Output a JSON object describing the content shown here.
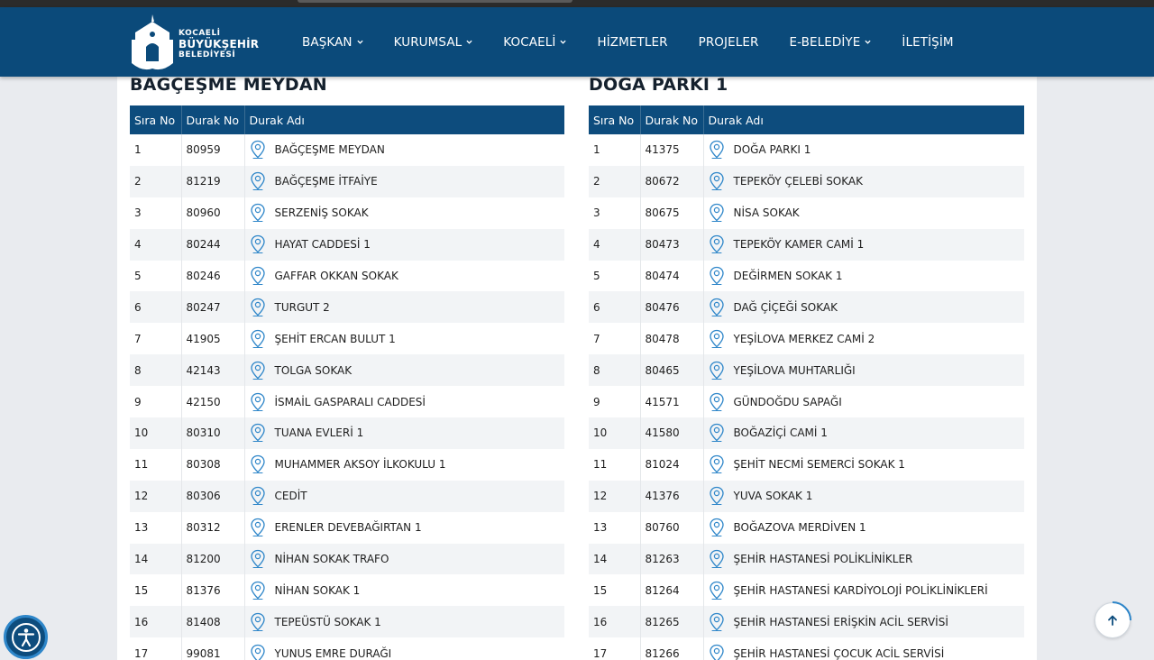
{
  "logo": {
    "line1": "KOCAELİ",
    "line2": "BÜYÜKŞEHİR",
    "line3": "BELEDİYESİ"
  },
  "nav": [
    {
      "label": "BAŞKAN",
      "dropdown": true
    },
    {
      "label": "KURUMSAL",
      "dropdown": true
    },
    {
      "label": "KOCAELİ",
      "dropdown": true
    },
    {
      "label": "HİZMETLER",
      "dropdown": false
    },
    {
      "label": "PROJELER",
      "dropdown": false
    },
    {
      "label": "E-BELEDİYE",
      "dropdown": true
    },
    {
      "label": "İLETİŞİM",
      "dropdown": false
    }
  ],
  "colors": {
    "header": "#0b4a7a",
    "table_header": "#0d4c7d",
    "accent": "#2e86c9"
  },
  "icons": {
    "stop": "map-pin-icon",
    "accessibility": "accessibility-icon",
    "scroll_top": "arrow-up-icon"
  },
  "columns": {
    "sira": "Sıra No",
    "durak_no": "Durak No",
    "durak_adi": "Durak Adı"
  },
  "left": {
    "title": "BAĞÇEŞME MEYDAN",
    "rows": [
      [
        "1",
        "80959",
        "BAĞÇEŞME MEYDAN"
      ],
      [
        "2",
        "81219",
        "BAĞÇEŞME İTFAİYE"
      ],
      [
        "3",
        "80960",
        "SERZENİŞ SOKAK"
      ],
      [
        "4",
        "80244",
        "HAYAT CADDESİ 1"
      ],
      [
        "5",
        "80246",
        "GAFFAR OKKAN SOKAK"
      ],
      [
        "6",
        "80247",
        "TURGUT 2"
      ],
      [
        "7",
        "41905",
        "ŞEHİT ERCAN BULUT 1"
      ],
      [
        "8",
        "42143",
        "TOLGA SOKAK"
      ],
      [
        "9",
        "42150",
        "İSMAİL GASPARALI CADDESİ"
      ],
      [
        "10",
        "80310",
        "TUANA EVLERİ 1"
      ],
      [
        "11",
        "80308",
        "MUHAMMER AKSOY İLKOKULU 1"
      ],
      [
        "12",
        "80306",
        "CEDİT"
      ],
      [
        "13",
        "80312",
        "ERENLER DEVEBAĞIRTAN 1"
      ],
      [
        "14",
        "81200",
        "NİHAN SOKAK TRAFO"
      ],
      [
        "15",
        "81376",
        "NİHAN SOKAK 1"
      ],
      [
        "16",
        "81408",
        "TEPEÜSTÜ SOKAK 1"
      ],
      [
        "17",
        "99081",
        "YUNUS EMRE DURAĞI"
      ]
    ]
  },
  "right": {
    "title": "DOĞA PARKI 1",
    "rows": [
      [
        "1",
        "41375",
        "DOĞA PARKI 1"
      ],
      [
        "2",
        "80672",
        "TEPEKÖY ÇELEBİ SOKAK"
      ],
      [
        "3",
        "80675",
        "NİSA SOKAK"
      ],
      [
        "4",
        "80473",
        "TEPEKÖY KAMER CAMİ 1"
      ],
      [
        "5",
        "80474",
        "DEĞİRMEN SOKAK 1"
      ],
      [
        "6",
        "80476",
        "DAĞ ÇİÇEĞİ SOKAK"
      ],
      [
        "7",
        "80478",
        "YEŞİLOVA MERKEZ CAMİ 2"
      ],
      [
        "8",
        "80465",
        "YEŞİLOVA MUHTARLIĞI"
      ],
      [
        "9",
        "41571",
        "GÜNDOĞDU SAPAĞI"
      ],
      [
        "10",
        "41580",
        "BOĞAZİÇİ CAMİ 1"
      ],
      [
        "11",
        "81024",
        "ŞEHİT NECMİ SEMERCİ SOKAK 1"
      ],
      [
        "12",
        "41376",
        "YUVA SOKAK 1"
      ],
      [
        "13",
        "80760",
        "BOĞAZOVA MERDİVEN 1"
      ],
      [
        "14",
        "81263",
        "ŞEHİR HASTANESİ POLİKLİNİKLER"
      ],
      [
        "15",
        "81264",
        "ŞEHİR HASTANESİ KARDİYOLOJİ POLİKLİNİKLERİ"
      ],
      [
        "16",
        "81265",
        "ŞEHİR HASTANESİ ERİŞKİN ACİL SERVİSİ"
      ],
      [
        "17",
        "81266",
        "ŞEHİR HASTANESİ ÇOCUK ACİL SERVİSİ"
      ]
    ]
  }
}
